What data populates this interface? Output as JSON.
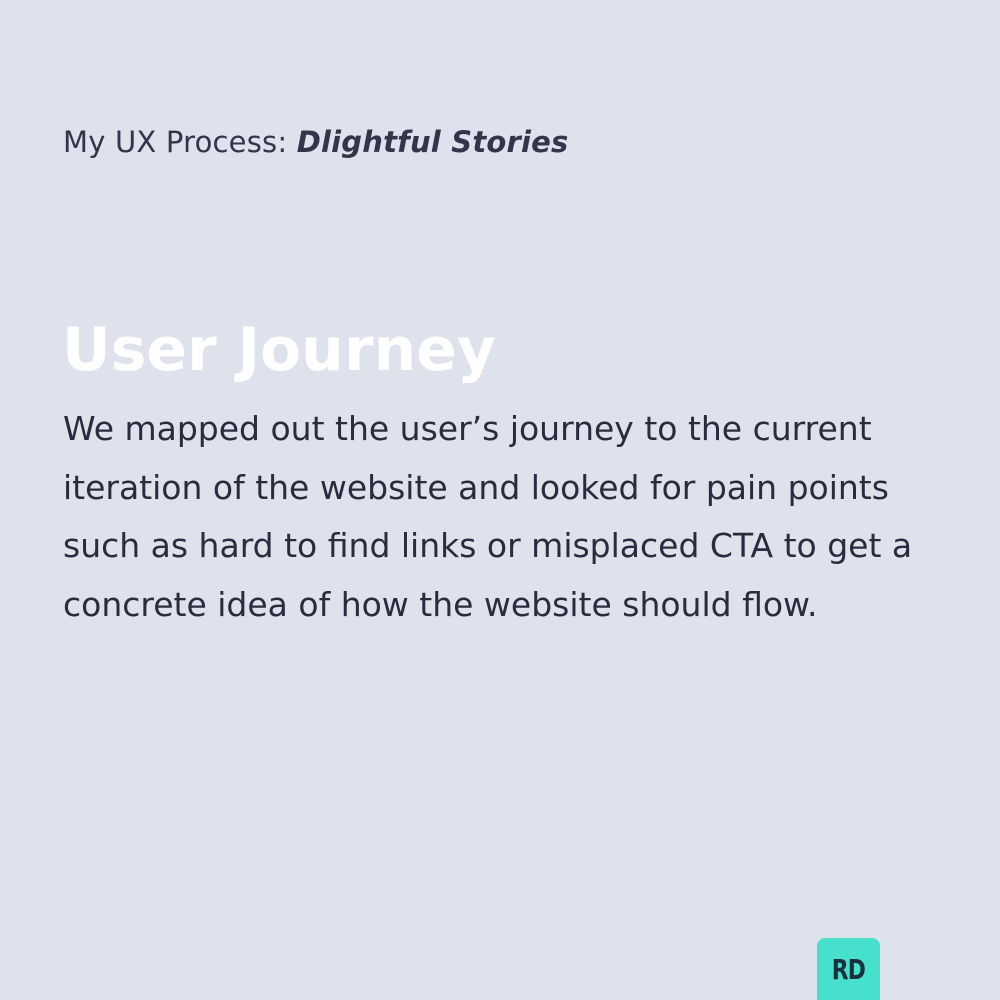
{
  "header": {
    "prefix": "My UX Process: ",
    "project": "Dlightful Stories"
  },
  "section": {
    "title": "User Journey",
    "body": "We mapped out the user’s journey to the current iteration of the website and looked for pain points such as hard to find links or misplaced CTA to get a concrete idea of how the website should flow."
  },
  "badge": {
    "text": "RD",
    "color": "#46e0cc"
  },
  "colors": {
    "background": "#dde2ec",
    "title": "#ffffff",
    "text": "#2a2c3e"
  }
}
